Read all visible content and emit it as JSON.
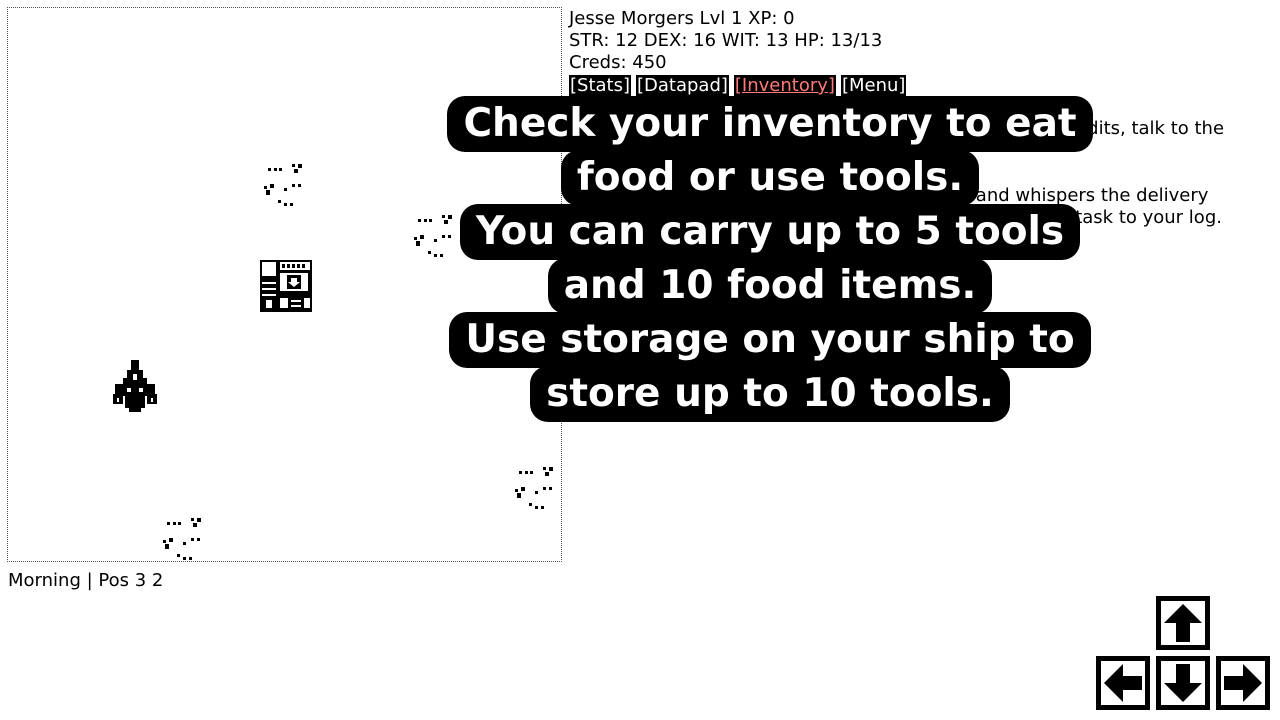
{
  "player": {
    "name_line": "Jesse Morgers Lvl 1 XP: 0",
    "stats_line": "STR: 12 DEX: 16 WIT: 13 HP: 13/13",
    "creds_line": "Creds: 450"
  },
  "menu": {
    "stats": "[Stats]",
    "datapad": "[Datapad]",
    "inventory": "[Inventory]",
    "menu": "[Menu]"
  },
  "log": {
    "line1": "0 credits, talk to the",
    "line2a": "e and whispers the delivery",
    "line2b": "he task to your log."
  },
  "tutorial": {
    "line1": "Check your inventory to eat",
    "line2": "food or use tools.",
    "line3": "You can carry up to 5 tools",
    "line4": "and 10 food items.",
    "line5": "Use storage on your ship to",
    "line6": "store up to 10 tools."
  },
  "status": "Morning | Pos 3 2",
  "icons": {
    "shop": "food-shop-icon",
    "ship": "player-ship-icon",
    "debris": "asteroid-debris-icon",
    "up": "arrow-up-icon",
    "down": "arrow-down-icon",
    "left": "arrow-left-icon",
    "right": "arrow-right-icon"
  }
}
